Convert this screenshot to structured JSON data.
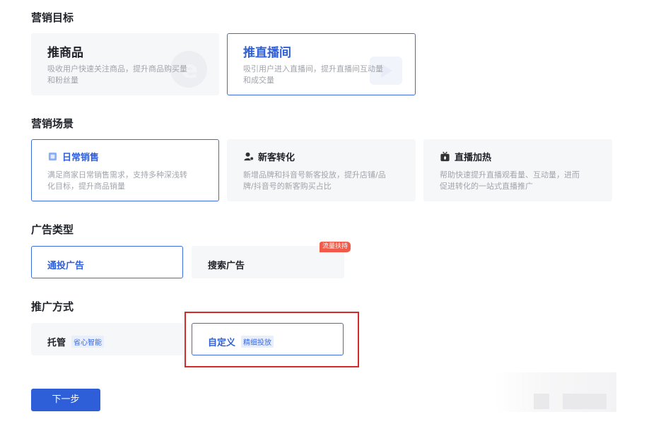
{
  "sections": {
    "goal": "营销目标",
    "scene": "营销场景",
    "ad_type": "广告类型",
    "method": "推广方式"
  },
  "goals": [
    {
      "title": "推商品",
      "desc_line1": "吸收用户快速关注商品，提升商品购买量",
      "desc_line2": "和粉丝量",
      "selected": false
    },
    {
      "title": "推直播间",
      "desc_line1": "吸引用户进入直播间，提升直播间互动量",
      "desc_line2": "和成交量",
      "selected": true
    }
  ],
  "scenes": [
    {
      "title": "日常销售",
      "icon": "daily-sales-icon",
      "desc_line1": "满足商家日常销售需求，支持多种深浅转",
      "desc_line2": "化目标，提升商品销量",
      "selected": true
    },
    {
      "title": "新客转化",
      "icon": "new-customer-icon",
      "desc_line1": "新增品牌和抖音号新客投放，提升店铺/品",
      "desc_line2": "牌/抖音号的新客购买占比",
      "selected": false
    },
    {
      "title": "直播加热",
      "icon": "live-boost-icon",
      "desc_line1": "帮助快速提升直播观看量、互动量，进而",
      "desc_line2": "促进转化的一站式直播推广",
      "selected": false
    }
  ],
  "ad_types": [
    {
      "label": "通投广告",
      "selected": true
    },
    {
      "label": "搜索广告",
      "selected": false,
      "badge": "流量扶持"
    }
  ],
  "methods": [
    {
      "label": "托管",
      "tag": "省心智能",
      "selected": false
    },
    {
      "label": "自定义",
      "tag": "精细投放",
      "selected": true
    }
  ],
  "next_button": "下一步",
  "colors": {
    "accent": "#2f5fd8",
    "highlight_box": "#d42a2a",
    "badge": "#f05a48"
  }
}
